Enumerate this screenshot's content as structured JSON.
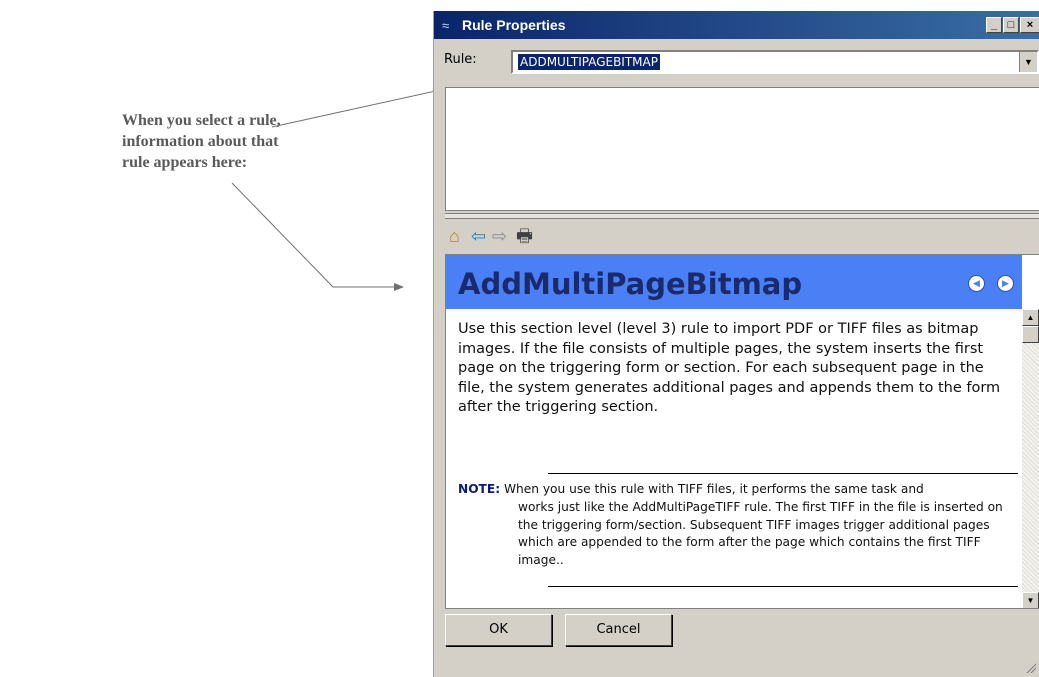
{
  "callout": {
    "lines": [
      "When you select a rule,",
      "information about that",
      "rule appears here:"
    ]
  },
  "window": {
    "title": "Rule Properties",
    "icon": "wave-app-icon",
    "controls": {
      "minimize": "_",
      "maximize": "□",
      "close": "×"
    }
  },
  "rule_field": {
    "label": "Rule:",
    "selected": "ADDMULTIPAGEBITMAP"
  },
  "help_toolbar": {
    "icons": [
      "home-icon",
      "back-arrow-icon",
      "forward-arrow-icon",
      "print-icon"
    ],
    "glyphs": {
      "home": "⌂",
      "back": "⇦",
      "forward": "⇨",
      "print": "🖶"
    }
  },
  "help": {
    "title": "AddMultiPageBitmap",
    "header_color": "#4a7ff5",
    "body": "Use this section level (level 3) rule to import PDF or TIFF files as bitmap images. If the file consists of multiple pages, the system inserts the first page on the triggering form or section. For each subsequent page in the file, the system generates additional pages and appends them to the form after the triggering section.",
    "note_label": "NOTE:",
    "note_first": "When you use this rule with TIFF files, it performs the same task and",
    "note_rest": "works just like the AddMultiPageTIFF rule. The first TIFF in the file is inserted on the triggering form/section. Subsequent TIFF images trigger additional pages which are appended to the form after the page which contains the first TIFF image.."
  },
  "buttons": {
    "ok": "OK",
    "cancel": "Cancel"
  },
  "colors": {
    "titlebar": "#0a246a",
    "dialog_bg": "#d4d0c8",
    "selection": "#0a246a",
    "callout_text": "#5a5a5a"
  }
}
